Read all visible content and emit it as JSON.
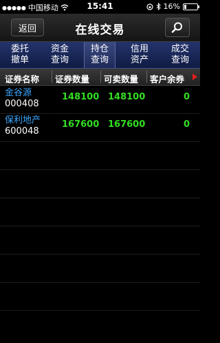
{
  "status_bar": {
    "signal_icon": "signal-dots-icon",
    "carrier": "中国移动",
    "wifi_icon": "wifi-icon",
    "time": "15:41",
    "lock_icon": "orientation-lock-icon",
    "bluetooth_icon": "bluetooth-icon",
    "battery_percent_label": "16%",
    "battery_level": 0.16
  },
  "navbar": {
    "back_label": "返回",
    "title": "在线交易",
    "search_icon": "search-icon"
  },
  "tabs": [
    {
      "line1": "委托",
      "line2": "撤单",
      "active": false
    },
    {
      "line1": "资金",
      "line2": "查询",
      "active": false
    },
    {
      "line1": "持仓",
      "line2": "查询",
      "active": true
    },
    {
      "line1": "信用",
      "line2": "资产",
      "active": false
    },
    {
      "line1": "成交",
      "line2": "查询",
      "active": false
    }
  ],
  "table": {
    "headers": [
      "证券名称",
      "证券数量",
      "可卖数量",
      "客户余券"
    ],
    "more_icon": "arrow-right-icon",
    "rows": [
      {
        "name": "金谷源",
        "code": "000408",
        "quantity": "148100",
        "sellable": "148100",
        "client_balance": "0"
      },
      {
        "name": "保利地产",
        "code": "600048",
        "quantity": "167600",
        "sellable": "167600",
        "client_balance": "0"
      }
    ]
  }
}
